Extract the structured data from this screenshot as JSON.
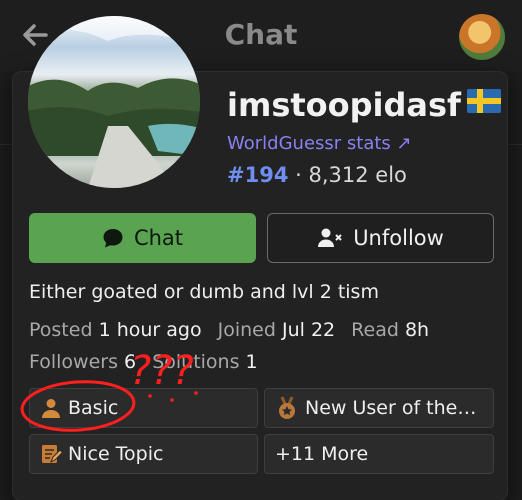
{
  "header": {
    "title": "Chat",
    "back_icon": "arrow-left-icon"
  },
  "profile": {
    "username": "imstoopidasf",
    "flag": "sweden-flag",
    "stats_link": "WorldGuessr stats ↗",
    "rank": "#194",
    "separator": "·",
    "elo": "8,312 elo",
    "bio": "Either goated or dumb and lvl 2 tism"
  },
  "actions": {
    "chat_label": "Chat",
    "unfollow_label": "Unfollow"
  },
  "meta": {
    "posted_label": "Posted",
    "posted_value": "1 hour ago",
    "joined_label": "Joined",
    "joined_value": "Jul 22",
    "read_label": "Read",
    "read_value": "8h",
    "followers_label": "Followers",
    "followers_value": "6",
    "solutions_label": "Solutions",
    "solutions_value": "1"
  },
  "badges": [
    {
      "label": "Basic",
      "icon": "user-icon",
      "color": "#d48a3c"
    },
    {
      "label": "New User of the…",
      "icon": "medal-icon",
      "color": "#b8783a"
    },
    {
      "label": "Nice Topic",
      "icon": "edit-document-icon",
      "color": "#c77b34"
    },
    {
      "label": "+11 More"
    }
  ],
  "annotation": {
    "text": "???",
    "color": "#ff1f1f"
  },
  "colors": {
    "accent_green": "#5aa351",
    "link_purple": "#8b80f0",
    "rank_blue": "#6e8ff0"
  }
}
